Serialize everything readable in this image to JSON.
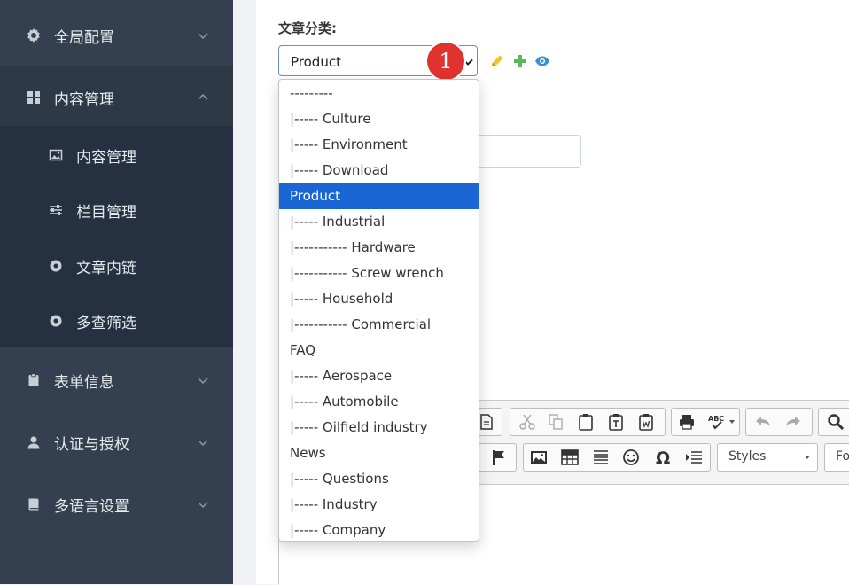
{
  "sidebar": {
    "menus": [
      {
        "label": "全局配置",
        "icon": "gear-icon"
      },
      {
        "label": "内容管理",
        "icon": "grid-icon"
      },
      {
        "label": "表单信息",
        "icon": "clipboard-icon"
      },
      {
        "label": "认证与授权",
        "icon": "user-icon"
      },
      {
        "label": "多语言设置",
        "icon": "book-icon"
      }
    ],
    "submenu": [
      {
        "label": "内容管理",
        "icon": "image-icon"
      },
      {
        "label": "栏目管理",
        "icon": "sliders-icon"
      },
      {
        "label": "文章内链",
        "icon": "dot-circle-icon"
      },
      {
        "label": "多查筛选",
        "icon": "dot-circle-icon"
      }
    ]
  },
  "form": {
    "category_label": "文章分类:",
    "selected": "Product",
    "badge": "1"
  },
  "dropdown": {
    "options": [
      "---------",
      "|----- Culture",
      "|----- Environment",
      "|----- Download",
      "Product",
      "|----- Industrial",
      "|----------- Hardware",
      "|----------- Screw wrench",
      "|----- Household",
      "|----------- Commercial",
      "FAQ",
      "|----- Aerospace",
      "|----- Automobile",
      "|----- Oilfield industry",
      "News",
      "|----- Questions",
      "|----- Industry",
      "|----- Company"
    ],
    "selected_index": 4
  },
  "editor": {
    "styles_label": "Styles",
    "format_label": "Fo"
  },
  "colors": {
    "sidebar": "#34404f",
    "selection": "#1a66d4",
    "badge": "#e0322e"
  }
}
